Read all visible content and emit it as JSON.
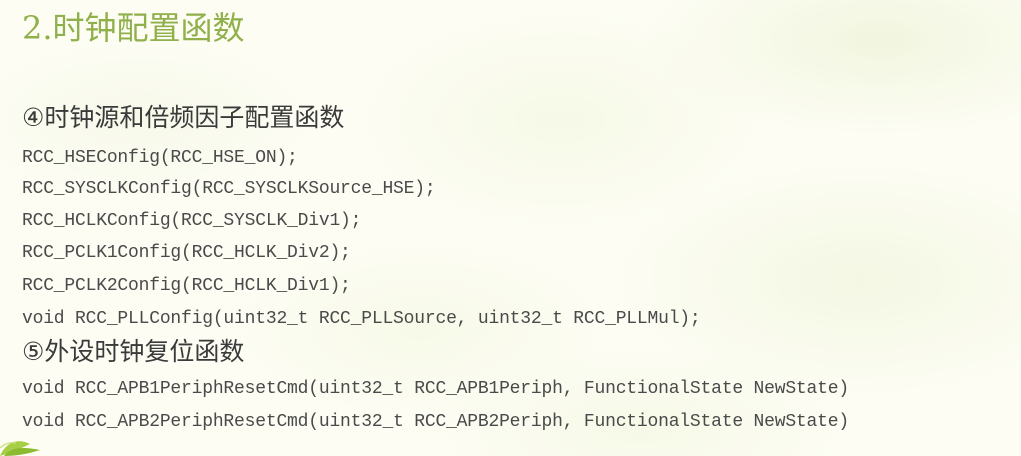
{
  "slide": {
    "title": "2.时钟配置函数",
    "section4": {
      "heading": "④时钟源和倍频因子配置函数",
      "lines": [
        "RCC_HSEConfig(RCC_HSE_ON);",
        "RCC_SYSCLKConfig(RCC_SYSCLKSource_HSE);",
        "RCC_HCLKConfig(RCC_SYSCLK_Div1);",
        "RCC_PCLK1Config(RCC_HCLK_Div2);",
        "RCC_PCLK2Config(RCC_HCLK_Div1);",
        "void RCC_PLLConfig(uint32_t RCC_PLLSource, uint32_t RCC_PLLMul);"
      ]
    },
    "section5": {
      "heading": "⑤外设时钟复位函数",
      "lines": [
        "void RCC_APB1PeriphResetCmd(uint32_t RCC_APB1Periph, FunctionalState NewState)",
        "void RCC_APB2PeriphResetCmd(uint32_t RCC_APB2Periph, FunctionalState NewState)"
      ]
    },
    "colors": {
      "title": "#8fb04a",
      "heading": "#3a3a3a",
      "code": "#4a4a4a",
      "leaf_accent": "#9cc43e"
    },
    "decoration_icon": "green-leaf-icon"
  }
}
